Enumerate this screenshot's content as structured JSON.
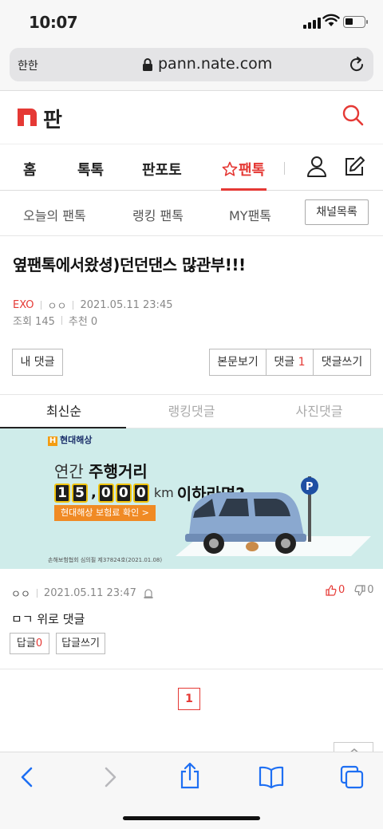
{
  "status_bar": {
    "time": "10:07"
  },
  "browser": {
    "aa_label": "한한",
    "url": "pann.nate.com"
  },
  "site": {
    "logo_text": "판"
  },
  "main_nav": {
    "items": [
      "홈",
      "톡톡",
      "판포토"
    ],
    "active_item": "팬톡"
  },
  "sub_nav": {
    "items": [
      "오늘의 팬톡",
      "랭킹 팬톡",
      "MY팬톡"
    ],
    "channel_button": "채널목록"
  },
  "post": {
    "title": "옆팬톡에서왔셩)던던댄스 많관부!!!",
    "category": "EXO",
    "author": "ㅇㅇ",
    "datetime": "2021.05.11 23:45",
    "views": "조회 145",
    "recommends": "추천 0"
  },
  "buttons": {
    "my_comments": "내 댓글",
    "view_post": "본문보기",
    "comments_label": "댓글",
    "comments_count": "1",
    "write_comment": "댓글쓰기"
  },
  "comment_tabs": [
    "최신순",
    "랭킹댓글",
    "사진댓글"
  ],
  "ad": {
    "brand": "현대해상",
    "line1_prefix": "연간",
    "line1_bold": "주행거리",
    "digits": [
      "1",
      "5",
      "0",
      "0",
      "0"
    ],
    "unit": "km",
    "condition": "이하라면?",
    "cta": "현대해상 보험료 확인 >",
    "disclaimer": "손해보험협회 심의필 제37824호(2021.01.08)"
  },
  "comment": {
    "author": "ㅇㅇ",
    "datetime": "2021.05.11 23:47",
    "up_count": "0",
    "down_count": "0",
    "body": "ㅁㄱ 위로 댓글",
    "reply_label": "답글",
    "reply_count": "0",
    "write_reply": "답글쓰기"
  },
  "pagination": {
    "current": "1"
  },
  "colors": {
    "accent": "#e53935",
    "ad_bg": "#cfecea"
  }
}
